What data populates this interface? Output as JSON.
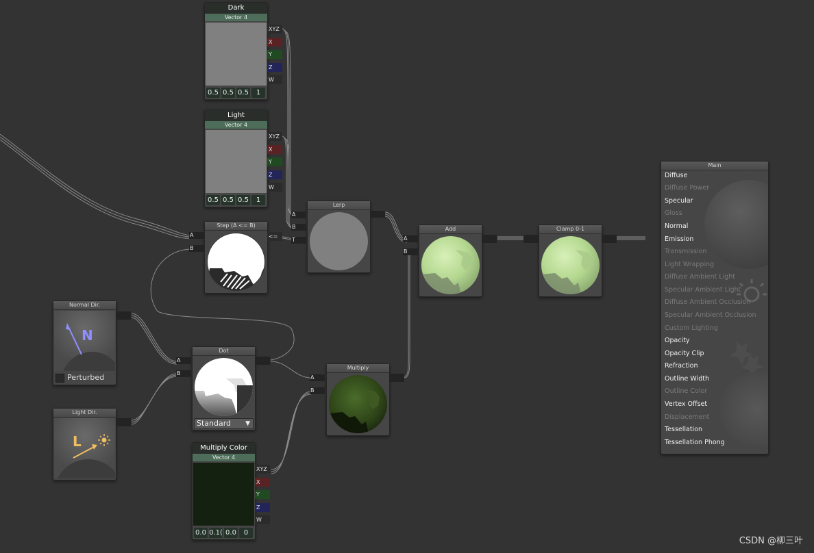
{
  "nodes": {
    "dark": {
      "title": "Dark",
      "subtitle": "Vector 4",
      "values": [
        "0.5",
        "0.5",
        "0.5",
        "1"
      ],
      "outputs": [
        "XYZ",
        "X",
        "Y",
        "Z",
        "W"
      ],
      "swatch_color": "#808080"
    },
    "light": {
      "title": "Light",
      "subtitle": "Vector 4",
      "values": [
        "0.5",
        "0.5",
        "0.5",
        "1"
      ],
      "outputs": [
        "XYZ",
        "X",
        "Y",
        "Z",
        "W"
      ],
      "swatch_color": "#808080"
    },
    "step": {
      "title": "Step (A <= B)",
      "inputs": [
        "A",
        "B"
      ],
      "output": "<="
    },
    "lerp": {
      "title": "Lerp",
      "inputs": [
        "A",
        "B",
        "T"
      ]
    },
    "add": {
      "title": "Add",
      "inputs": [
        "A",
        "B"
      ]
    },
    "clamp": {
      "title": "Clamp 0-1"
    },
    "normal_dir": {
      "title": "Normal Dir.",
      "glyph": "N",
      "checkbox_label": "Perturbed"
    },
    "light_dir": {
      "title": "Light Dir.",
      "glyph": "L"
    },
    "dot": {
      "title": "Dot",
      "inputs": [
        "A",
        "B"
      ],
      "dropdown": "Standard"
    },
    "multiply": {
      "title": "Multiply",
      "inputs": [
        "A",
        "B"
      ]
    },
    "multiply_color": {
      "title": "Multiply Color",
      "subtitle": "Vector 4",
      "values": [
        "0.0",
        "0.1(",
        "0.0",
        "0"
      ],
      "outputs": [
        "XYZ",
        "X",
        "Y",
        "Z",
        "W"
      ],
      "swatch_color": "#142010"
    }
  },
  "main": {
    "title": "Main",
    "inputs": [
      {
        "label": "Diffuse",
        "enabled": true
      },
      {
        "label": "Diffuse Power",
        "enabled": false
      },
      {
        "label": "Specular",
        "enabled": true
      },
      {
        "label": "Gloss",
        "enabled": false
      },
      {
        "label": "Normal",
        "enabled": true
      },
      {
        "label": "Emission",
        "enabled": true
      },
      {
        "label": "Transmission",
        "enabled": false
      },
      {
        "label": "Light Wrapping",
        "enabled": false
      },
      {
        "label": "Diffuse Ambient Light",
        "enabled": false
      },
      {
        "label": "Specular Ambient Light",
        "enabled": false
      },
      {
        "label": "Diffuse Ambient Occlusion",
        "enabled": false
      },
      {
        "label": "Specular Ambient Occlusion",
        "enabled": false
      },
      {
        "label": "Custom Lighting",
        "enabled": false
      },
      {
        "label": "Opacity",
        "enabled": true
      },
      {
        "label": "Opacity Clip",
        "enabled": true
      },
      {
        "label": "Refraction",
        "enabled": true
      },
      {
        "label": "Outline Width",
        "enabled": true
      },
      {
        "label": "Outline Color",
        "enabled": false
      },
      {
        "label": "Vertex Offset",
        "enabled": true
      },
      {
        "label": "Displacement",
        "enabled": false
      },
      {
        "label": "Tessellation",
        "enabled": true
      },
      {
        "label": "Tessellation Phong",
        "enabled": true
      }
    ]
  },
  "watermark": "CSDN @柳三叶",
  "colors": {
    "canvas": "#333333",
    "node": "#464646",
    "property_header": "#4d6c59",
    "wire": "#9a9a9a",
    "x_slot": "#5a2222",
    "y_slot": "#1f4a22",
    "z_slot": "#23255a",
    "normal_glyph": "#8f8fff",
    "light_glyph": "#f0c060"
  }
}
